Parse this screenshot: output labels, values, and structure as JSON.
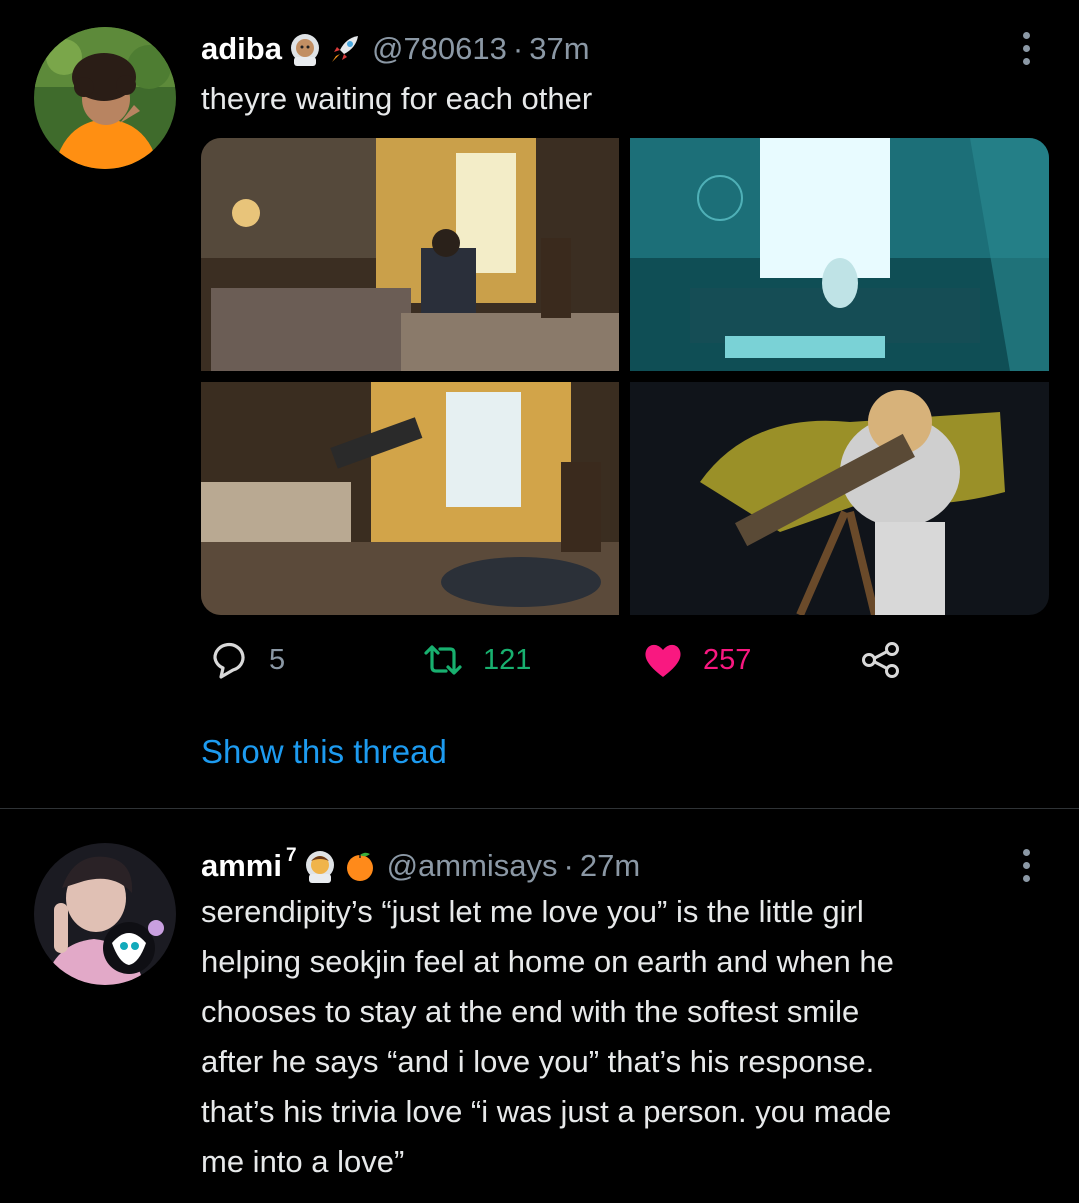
{
  "tweets": [
    {
      "name": "adiba",
      "handle": "@780613",
      "separator": "·",
      "time": "37m",
      "emojis": [
        "astronaut-emoji",
        "rocket-emoji"
      ],
      "text": "theyre waiting for each other",
      "media": [
        "bedroom-telescope-photo",
        "teal-room-photo",
        "telescope-bedroom-photo",
        "boy-telescope-photo"
      ],
      "replies": "5",
      "retweets": "121",
      "likes": "257",
      "show_thread": "Show this thread"
    },
    {
      "name": "ammi",
      "superscript": "7",
      "handle": "@ammisays",
      "separator": "·",
      "time": "27m",
      "emojis": [
        "astronaut-emoji",
        "orange-emoji"
      ],
      "lines": [
        "serendipity’s “just let me love you” is the little girl",
        "helping seokjin feel at home on earth and when he",
        "chooses to stay at the end with the softest smile",
        "after he says “and i love you” that’s his response.",
        "that’s his trivia love “i was just a person. you made",
        "me into a love”"
      ]
    }
  ],
  "colors": {
    "background": "#000000",
    "secondary_text": "#8b98a5",
    "link": "#1d9bf0",
    "retweet": "#18b06f",
    "like": "#f91880"
  }
}
